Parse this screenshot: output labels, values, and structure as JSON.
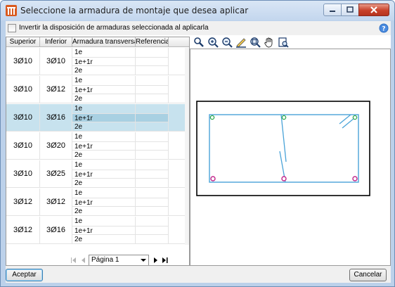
{
  "window": {
    "title": "Seleccione la armadura de montaje que desea aplicar"
  },
  "options": {
    "invert_label": "Invertir la disposición de armaduras seleccionada al aplicarla",
    "invert_checked": false
  },
  "table": {
    "columns": [
      "Superior",
      "Inferior",
      "Armadura transversal",
      "Referencia"
    ],
    "sub_labels": [
      "1e",
      "1e+1r",
      "2e"
    ],
    "rows": [
      {
        "superior": "3Ø10",
        "inferior": "3Ø10",
        "selected": false
      },
      {
        "superior": "3Ø10",
        "inferior": "3Ø12",
        "selected": false
      },
      {
        "superior": "3Ø10",
        "inferior": "3Ø16",
        "selected": true
      },
      {
        "superior": "3Ø10",
        "inferior": "3Ø20",
        "selected": false
      },
      {
        "superior": "3Ø10",
        "inferior": "3Ø25",
        "selected": false
      },
      {
        "superior": "3Ø12",
        "inferior": "3Ø12",
        "selected": false
      },
      {
        "superior": "3Ø12",
        "inferior": "3Ø16",
        "selected": false
      }
    ]
  },
  "pager": {
    "page_label": "Página 1"
  },
  "toolbar": {
    "icons": [
      "zoom-window-icon",
      "zoom-in-icon",
      "zoom-out-icon",
      "pencil-icon",
      "zoom-extents-icon",
      "pan-hand-icon",
      "print-preview-icon"
    ]
  },
  "buttons": {
    "accept": "Aceptar",
    "cancel": "Cancelar"
  },
  "colors": {
    "selected_row": "#c7e2ee",
    "rebar_stroke": "#4aa3d8",
    "top_bar_marker": "#2ca84a",
    "bottom_bar_marker": "#c2278c",
    "close_button": "#c8412a"
  }
}
